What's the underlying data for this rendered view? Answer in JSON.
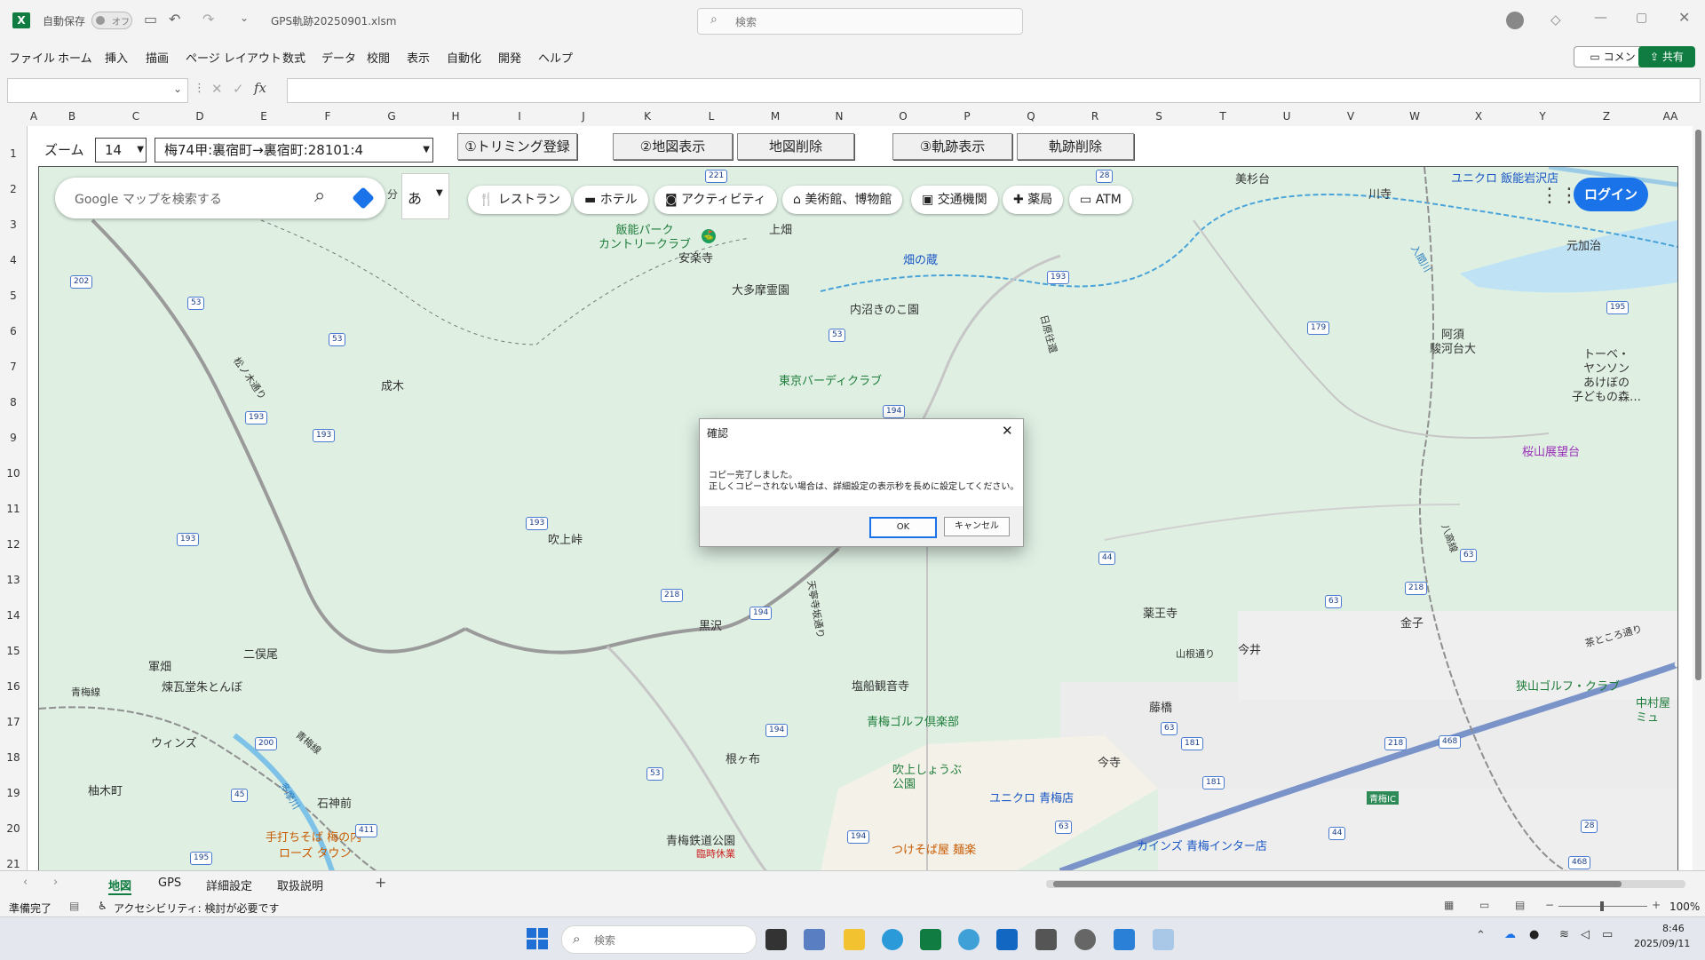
{
  "titlebar": {
    "autosave_label": "自動保存",
    "autosave_state": "オフ",
    "filename": "GPS軌跡20250901.xlsm",
    "search_placeholder": "検索"
  },
  "ribbon": {
    "menus": [
      "ファイル",
      "ホーム",
      "挿入",
      "描画",
      "ページ レイアウト",
      "数式",
      "データ",
      "校閲",
      "表示",
      "自動化",
      "開発",
      "ヘルプ"
    ],
    "comment_label": "コメント",
    "share_label": "共有"
  },
  "formula": {
    "fx": "fx"
  },
  "columns": [
    "A",
    "B",
    "C",
    "D",
    "E",
    "F",
    "G",
    "H",
    "I",
    "J",
    "K",
    "L",
    "M",
    "N",
    "O",
    "P",
    "Q",
    "R",
    "S",
    "T",
    "U",
    "V",
    "W",
    "X",
    "Y",
    "Z",
    "AA"
  ],
  "rows": [
    "1",
    "2",
    "3",
    "4",
    "5",
    "6",
    "7",
    "8",
    "9",
    "10",
    "11",
    "12",
    "13",
    "14",
    "15",
    "16",
    "17",
    "18",
    "19",
    "20",
    "21"
  ],
  "sheet_controls": {
    "zoom_label": "ズーム",
    "zoom_value": "14",
    "route_value": "梅74甲:裏宿町→裏宿町:28101:4",
    "btn_trim": "①トリミング登録",
    "btn_map_show": "②地図表示",
    "btn_map_delete": "地図削除",
    "btn_track_show": "③軌跡表示",
    "btn_track_delete": "軌跡削除",
    "side_text": "分"
  },
  "map": {
    "search_placeholder": "Google マップを検索する",
    "ime_label": "あ",
    "chips": [
      "レストラン",
      "ホテル",
      "アクティビティ",
      "美術館、博物館",
      "交通機関",
      "薬局",
      "ATM"
    ],
    "login_label": "ログイン",
    "places": [
      {
        "name": "飯能パーク\nカントリークラブ"
      },
      {
        "name": "上畑"
      },
      {
        "name": "安楽寺"
      },
      {
        "name": "畑の蔵"
      },
      {
        "name": "大多摩霊園"
      },
      {
        "name": "内沼きのこ園"
      },
      {
        "name": "東京バーディクラブ"
      },
      {
        "name": "成木"
      },
      {
        "name": "吹上峠"
      },
      {
        "name": "黒沢"
      },
      {
        "name": "二俣尾"
      },
      {
        "name": "軍畑"
      },
      {
        "name": "煉瓦堂朱とんぼ"
      },
      {
        "name": "ウィンズ"
      },
      {
        "name": "柚木町"
      },
      {
        "name": "石神前"
      },
      {
        "name": "手打ちそば 梅の内"
      },
      {
        "name": "ローズ タウン"
      },
      {
        "name": "青梅線"
      },
      {
        "name": "塩船観音寺"
      },
      {
        "name": "青梅ゴルフ倶楽部"
      },
      {
        "name": "吹上しょうぶ\n公園"
      },
      {
        "name": "根ヶ布"
      },
      {
        "name": "青梅鉄道公園"
      },
      {
        "name": "臨時休業"
      },
      {
        "name": "つけそば屋 麺楽"
      },
      {
        "name": "ユニクロ 青梅店"
      },
      {
        "name": "カインズ 青梅インター店"
      },
      {
        "name": "薬王寺"
      },
      {
        "name": "今井"
      },
      {
        "name": "藤橋"
      },
      {
        "name": "今寺"
      },
      {
        "name": "金子"
      },
      {
        "name": "狭山ゴルフ・クラブ"
      },
      {
        "name": "中村屋\nミュ"
      },
      {
        "name": "桜山展望台"
      },
      {
        "name": "トーベ・\nヤンソン\nあけぼの\n子どもの森…"
      },
      {
        "name": "阿須\n駿河台大"
      },
      {
        "name": "元加治"
      },
      {
        "name": "ユニクロ 飯能岩沢店"
      },
      {
        "name": "美杉台"
      },
      {
        "name": "川寺"
      },
      {
        "name": "青梅IC"
      },
      {
        "name": "八高線"
      },
      {
        "name": "入間川"
      },
      {
        "name": "日原往還"
      },
      {
        "name": "山根通り"
      },
      {
        "name": "茶ところ通り"
      },
      {
        "name": "松ノ木通り"
      },
      {
        "name": "天寧寺坂通り"
      },
      {
        "name": "多摩川"
      },
      {
        "name": "青梅線"
      }
    ],
    "routes": [
      "221",
      "28",
      "202",
      "53",
      "53",
      "193",
      "193",
      "193",
      "193",
      "194",
      "194",
      "194",
      "194",
      "200",
      "45",
      "411",
      "53",
      "63",
      "181",
      "181",
      "44",
      "44",
      "63",
      "218",
      "218",
      "468",
      "468",
      "179",
      "195",
      "195",
      "28",
      "218",
      "53",
      "193",
      "63",
      "63"
    ]
  },
  "dialog": {
    "title": "確認",
    "line1": "コピー完了しました。",
    "line2": "正しくコピーされない場合は、詳細設定の表示秒を長めに設定してください。",
    "ok": "OK",
    "cancel": "キャンセル"
  },
  "tabs": {
    "sheets": [
      "地図",
      "GPS",
      "詳細設定",
      "取扱説明"
    ],
    "add": "+"
  },
  "status": {
    "ready": "準備完了",
    "accessibility": "アクセシビリティ: 検討が必要です",
    "zoom": "100%"
  },
  "taskbar": {
    "search_placeholder": "検索",
    "time": "8:46",
    "date": "2025/09/11"
  }
}
